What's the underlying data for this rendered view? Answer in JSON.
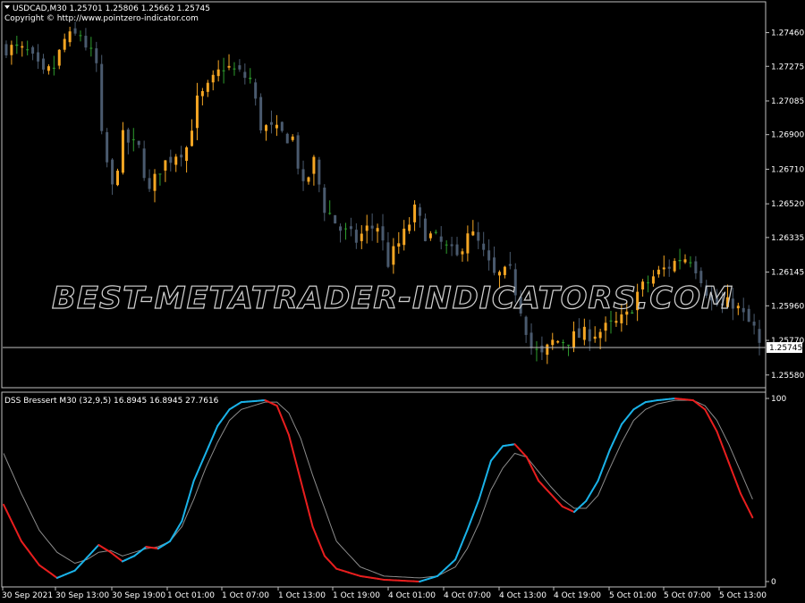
{
  "header": {
    "symbol_line": "USDCAD,M30  1.25701 1.25806 1.25662 1.25745",
    "copyright": "Copyright © http://www.pointzero-indicator.com"
  },
  "watermark": "BEST-METATRADER-INDICATORS.COM",
  "indicator_label": "DSS Bressert M30 (32,9,5) 16.8945 16.8945 27.7616",
  "current_price_label": "1.25745",
  "colors": {
    "bull_candle": "#f5a623",
    "bear_candle": "#4a5a6e",
    "doji_candle": "#2e9e2e",
    "dss_up": "#1ab2e8",
    "dss_down": "#e81e1e",
    "signal": "#8c8c8c",
    "grid_frame": "#bfbfbf"
  },
  "chart_data": [
    {
      "type": "candlestick",
      "symbol": "USDCAD",
      "timeframe": "M30",
      "ylim": [
        1.2552,
        1.276
      ],
      "y_ticks": [
        "1.27460",
        "1.27275",
        "1.27085",
        "1.26900",
        "1.26710",
        "1.26520",
        "1.26335",
        "1.26145",
        "1.25960",
        "1.25770",
        "1.25580"
      ],
      "x_ticks": [
        "30 Sep 2021",
        "30 Sep 13:00",
        "30 Sep 19:00",
        "1 Oct 01:00",
        "1 Oct 07:00",
        "1 Oct 13:00",
        "1 Oct 19:00",
        "4 Oct 01:00",
        "4 Oct 07:00",
        "4 Oct 13:00",
        "4 Oct 19:00",
        "5 Oct 01:00",
        "5 Oct 07:00",
        "5 Oct 13:00"
      ],
      "close_anchors": [
        [
          0,
          1.2738
        ],
        [
          4,
          1.2735
        ],
        [
          7,
          1.2722
        ],
        [
          9,
          1.2727
        ],
        [
          11,
          1.2742
        ],
        [
          14,
          1.2745
        ],
        [
          17,
          1.2728
        ],
        [
          18,
          1.2688
        ],
        [
          20,
          1.266
        ],
        [
          22,
          1.2688
        ],
        [
          25,
          1.2682
        ],
        [
          27,
          1.2658
        ],
        [
          29,
          1.2672
        ],
        [
          32,
          1.268
        ],
        [
          34,
          1.2683
        ],
        [
          36,
          1.2708
        ],
        [
          38,
          1.2715
        ],
        [
          41,
          1.2728
        ],
        [
          43,
          1.2725
        ],
        [
          46,
          1.272
        ],
        [
          48,
          1.2695
        ],
        [
          52,
          1.269
        ],
        [
          54,
          1.2688
        ],
        [
          56,
          1.266
        ],
        [
          58,
          1.2675
        ],
        [
          60,
          1.265
        ],
        [
          63,
          1.2638
        ],
        [
          66,
          1.2632
        ],
        [
          68,
          1.2638
        ],
        [
          70,
          1.264
        ],
        [
          72,
          1.262
        ],
        [
          75,
          1.2635
        ],
        [
          77,
          1.2648
        ],
        [
          79,
          1.2636
        ],
        [
          82,
          1.263
        ],
        [
          85,
          1.2622
        ],
        [
          87,
          1.2638
        ],
        [
          89,
          1.263
        ],
        [
          92,
          1.2612
        ],
        [
          95,
          1.2614
        ],
        [
          97,
          1.2595
        ],
        [
          99,
          1.2573
        ],
        [
          101,
          1.2568
        ],
        [
          103,
          1.2576
        ],
        [
          106,
          1.2578
        ],
        [
          109,
          1.258
        ],
        [
          112,
          1.2582
        ],
        [
          115,
          1.2586
        ],
        [
          117,
          1.259
        ],
        [
          119,
          1.2603
        ],
        [
          122,
          1.2612
        ],
        [
          125,
          1.2618
        ],
        [
          127,
          1.2622
        ],
        [
          129,
          1.2623
        ],
        [
          131,
          1.2612
        ],
        [
          133,
          1.2598
        ],
        [
          135,
          1.2595
        ],
        [
          137,
          1.2598
        ],
        [
          139,
          1.259
        ],
        [
          141,
          1.2583
        ],
        [
          142,
          1.2574
        ]
      ]
    },
    {
      "type": "line",
      "name": "DSS Bressert",
      "ylim": [
        0,
        100
      ],
      "y_ticks": [
        "100",
        "0"
      ],
      "series": [
        {
          "role": "dss",
          "values": [
            [
              0,
              42
            ],
            [
              3,
              22
            ],
            [
              6,
              9
            ],
            [
              9,
              2
            ],
            [
              12,
              6
            ],
            [
              14,
              13
            ],
            [
              16,
              20
            ],
            [
              18,
              16
            ],
            [
              20,
              11
            ],
            [
              22,
              14
            ],
            [
              24,
              19
            ],
            [
              26,
              18
            ],
            [
              28,
              22
            ],
            [
              30,
              33
            ],
            [
              32,
              55
            ],
            [
              34,
              70
            ],
            [
              36,
              85
            ],
            [
              38,
              94
            ],
            [
              40,
              98
            ],
            [
              44,
              99
            ],
            [
              46,
              96
            ],
            [
              48,
              80
            ],
            [
              50,
              55
            ],
            [
              52,
              30
            ],
            [
              54,
              14
            ],
            [
              56,
              7
            ],
            [
              60,
              3
            ],
            [
              64,
              1
            ],
            [
              70,
              0
            ],
            [
              73,
              3
            ],
            [
              76,
              12
            ],
            [
              78,
              28
            ],
            [
              80,
              45
            ],
            [
              82,
              66
            ],
            [
              84,
              74
            ],
            [
              86,
              75
            ],
            [
              88,
              68
            ],
            [
              90,
              55
            ],
            [
              92,
              48
            ],
            [
              94,
              41
            ],
            [
              96,
              38
            ],
            [
              98,
              44
            ],
            [
              100,
              55
            ],
            [
              102,
              72
            ],
            [
              104,
              86
            ],
            [
              106,
              94
            ],
            [
              108,
              98
            ],
            [
              110,
              99
            ],
            [
              113,
              100
            ],
            [
              116,
              99
            ],
            [
              118,
              94
            ],
            [
              120,
              82
            ],
            [
              122,
              65
            ],
            [
              124,
              48
            ],
            [
              126,
              35
            ]
          ]
        },
        {
          "role": "signal",
          "values": [
            [
              0,
              70
            ],
            [
              3,
              48
            ],
            [
              6,
              28
            ],
            [
              9,
              16
            ],
            [
              12,
              10
            ],
            [
              14,
              12
            ],
            [
              16,
              16
            ],
            [
              18,
              17
            ],
            [
              20,
              14
            ],
            [
              22,
              16
            ],
            [
              24,
              18
            ],
            [
              26,
              19
            ],
            [
              28,
              22
            ],
            [
              30,
              30
            ],
            [
              32,
              45
            ],
            [
              34,
              62
            ],
            [
              36,
              76
            ],
            [
              38,
              88
            ],
            [
              40,
              94
            ],
            [
              42,
              96
            ],
            [
              44,
              98
            ],
            [
              46,
              98
            ],
            [
              48,
              92
            ],
            [
              50,
              78
            ],
            [
              52,
              58
            ],
            [
              54,
              40
            ],
            [
              56,
              22
            ],
            [
              60,
              8
            ],
            [
              64,
              3
            ],
            [
              70,
              2
            ],
            [
              73,
              3
            ],
            [
              76,
              8
            ],
            [
              78,
              18
            ],
            [
              80,
              32
            ],
            [
              82,
              50
            ],
            [
              84,
              62
            ],
            [
              86,
              70
            ],
            [
              88,
              68
            ],
            [
              90,
              60
            ],
            [
              92,
              52
            ],
            [
              94,
              45
            ],
            [
              96,
              40
            ],
            [
              98,
              40
            ],
            [
              100,
              47
            ],
            [
              102,
              62
            ],
            [
              104,
              76
            ],
            [
              106,
              88
            ],
            [
              108,
              94
            ],
            [
              110,
              97
            ],
            [
              113,
              99
            ],
            [
              116,
              99
            ],
            [
              118,
              96
            ],
            [
              120,
              88
            ],
            [
              122,
              75
            ],
            [
              124,
              60
            ],
            [
              126,
              45
            ]
          ]
        }
      ]
    }
  ]
}
